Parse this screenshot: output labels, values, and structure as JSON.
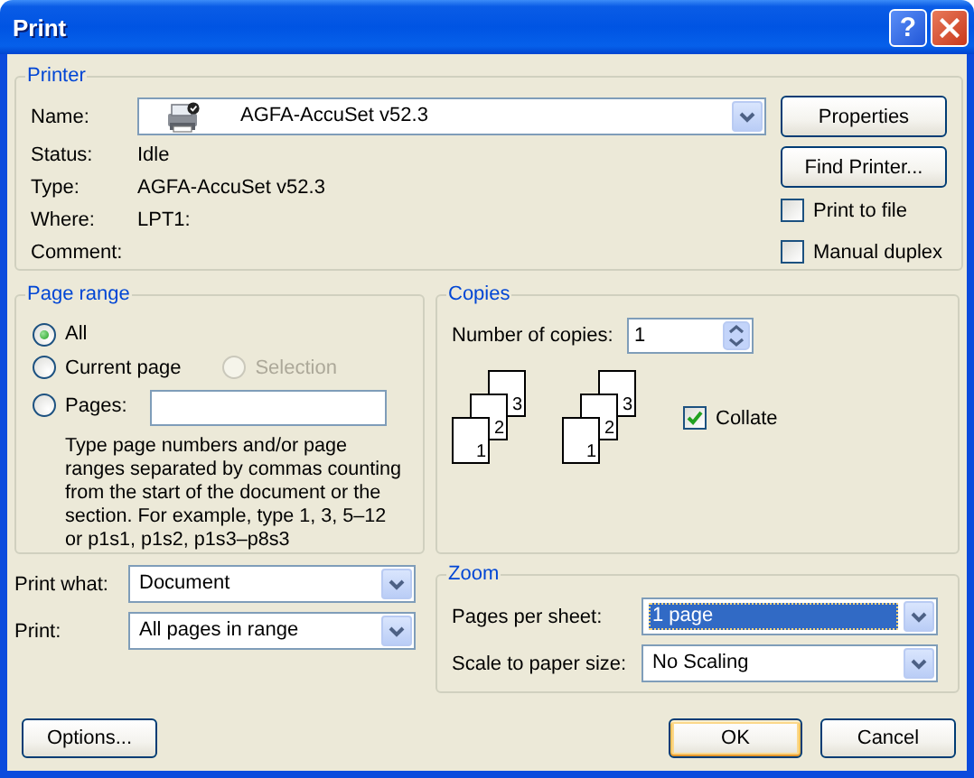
{
  "window": {
    "title": "Print",
    "help_label": "?"
  },
  "printer": {
    "title": "Printer",
    "name_label": "Name:",
    "name_value": "AGFA-AccuSet v52.3",
    "info": [
      {
        "label": "Status:",
        "value": "Idle"
      },
      {
        "label": "Type:",
        "value": "AGFA-AccuSet v52.3"
      },
      {
        "label": "Where:",
        "value": "LPT1:"
      },
      {
        "label": "Comment:"
      }
    ],
    "buttons": [
      "Properties",
      "Find Printer..."
    ],
    "options": [
      {
        "label": "Print to file",
        "checked": false
      },
      {
        "label": "Manual duplex",
        "checked": false
      }
    ]
  },
  "page_range": {
    "title": "Page range",
    "rows": [
      {
        "options": [
          {
            "kind": "radio",
            "label": "All",
            "selected": true,
            "disabled": false
          }
        ]
      },
      {
        "options": [
          {
            "kind": "radio",
            "label": "Current page",
            "selected": false,
            "disabled": false
          },
          {
            "kind": "radio",
            "label": "Selection",
            "selected": false,
            "disabled": true
          }
        ]
      },
      {
        "options": [
          {
            "kind": "field",
            "label": "Pages:",
            "selected": false,
            "disabled": false
          }
        ]
      }
    ],
    "help": "Type page numbers and/or page ranges separated by commas counting from the start of the document or the section. For example, type 1, 3, 5–12 or p1s1, p1s2, p1s3–p8s3"
  },
  "copies": {
    "title": "Copies",
    "label": "Number of copies:",
    "value": "1",
    "stacks": [
      {
        "pages": [
          "1",
          "2",
          "3"
        ]
      },
      {
        "pages": [
          "1",
          "2",
          "3"
        ]
      }
    ],
    "collate": {
      "label": "Collate",
      "checked": true
    }
  },
  "print_what": {
    "label": "Print what:",
    "value": "Document"
  },
  "print": {
    "label": "Print:",
    "value": "All pages in range"
  },
  "zoom": {
    "title": "Zoom",
    "rows": [
      {
        "label": "Pages per sheet:",
        "value": "1 page",
        "focused": true
      },
      {
        "label": "Scale to paper size:",
        "value": "No Scaling",
        "focused": false
      }
    ]
  },
  "footer_buttons": [
    {
      "label": "Options...",
      "default": false
    },
    {
      "label": "OK",
      "default": true
    },
    {
      "label": "Cancel",
      "default": false
    }
  ]
}
